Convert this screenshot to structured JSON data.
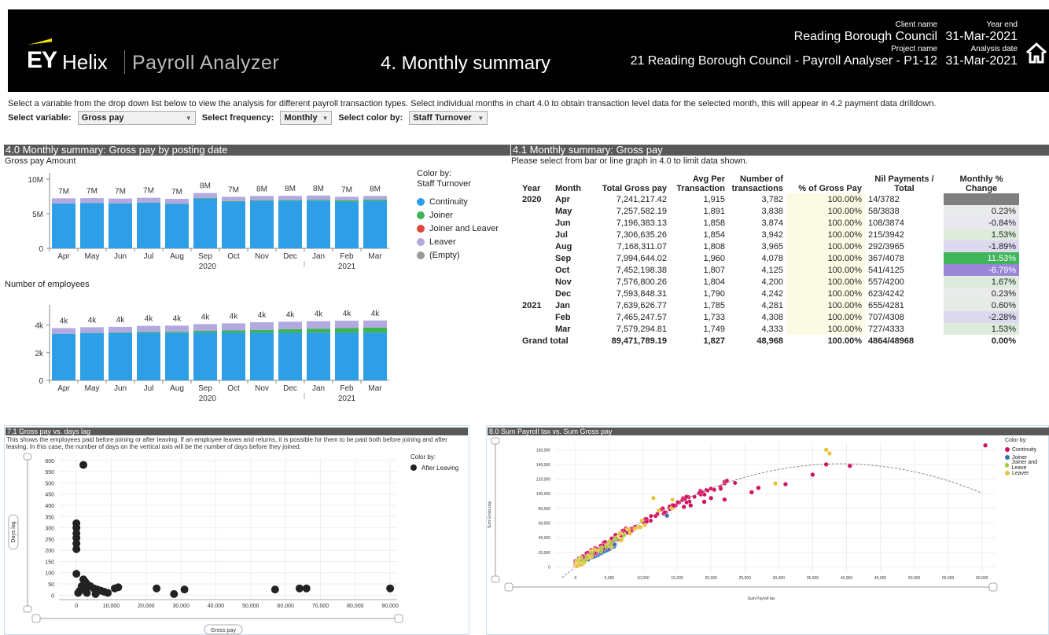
{
  "header": {
    "logo_ey": "EY",
    "logo_helix": "Helix",
    "logo_product": "Payroll Analyzer",
    "page_title": "4. Monthly summary",
    "client_label": "Client name",
    "client_value": "Reading Borough Council",
    "project_label": "Project name",
    "project_value": "21 Reading Borough Council - Payroll Analyser - P1-12",
    "yearend_label": "Year end",
    "yearend_value": "31-Mar-2021",
    "analysisdate_label": "Analysis date",
    "analysisdate_value": "31-Mar-2021",
    "home_icon": "home-icon"
  },
  "instructions": "Select a variable from the drop down list below to view the analysis for different payroll transaction types. Select individual months in chart 4.0 to obtain transaction level data for the selected month, this will appear in 4.2 payment data drilldown.",
  "controls": {
    "variable_label": "Select variable:",
    "variable_value": "Gross pay",
    "frequency_label": "Select frequency:",
    "frequency_value": "Monthly",
    "color_label": "Select color by:",
    "color_value": "Staff Turnover"
  },
  "section40": {
    "title": "4.0 Monthly summary: Gross pay by posting date",
    "chart1_title": "Gross pay Amount",
    "chart2_title": "Number of employees",
    "legend_title1": "Color by:",
    "legend_title2": "Staff Turnover",
    "legend": [
      {
        "label": "Continuity",
        "color": "#2e9fe6"
      },
      {
        "label": "Joiner",
        "color": "#3cb454"
      },
      {
        "label": "Joiner and Leaver",
        "color": "#e0473c"
      },
      {
        "label": "Leaver",
        "color": "#b3a8e0"
      },
      {
        "label": "(Empty)",
        "color": "#9a9a9a"
      }
    ],
    "months": [
      "Apr",
      "May",
      "Jun",
      "Jul",
      "Aug",
      "Sep",
      "Oct",
      "Nov",
      "Dec",
      "Jan",
      "Feb",
      "Mar"
    ],
    "years": [
      "2020",
      "2021"
    ],
    "chart1_ticks": [
      "10M",
      "5M",
      "0"
    ],
    "chart2_ticks": [
      "4k",
      "2k",
      "0"
    ]
  },
  "chart_data": [
    {
      "type": "bar",
      "title": "Gross pay Amount",
      "categories": [
        "Apr",
        "May",
        "Jun",
        "Jul",
        "Aug",
        "Sep",
        "Oct",
        "Nov",
        "Dec",
        "Jan",
        "Feb",
        "Mar"
      ],
      "ylim": [
        0,
        10000000
      ],
      "data_labels": [
        "7M",
        "7M",
        "7M",
        "7M",
        "7M",
        "8M",
        "7M",
        "8M",
        "8M",
        "8M",
        "7M",
        "8M"
      ],
      "series": [
        {
          "name": "Continuity",
          "values": [
            6500000,
            6550000,
            6480000,
            6600000,
            6420000,
            7200000,
            6750000,
            6870000,
            6870000,
            6910000,
            6750000,
            6860000
          ]
        },
        {
          "name": "Joiner",
          "values": [
            0,
            20000,
            30000,
            30000,
            40000,
            70000,
            80000,
            100000,
            110000,
            120000,
            200000,
            200000
          ]
        },
        {
          "name": "Joiner and Leaver",
          "values": [
            0,
            0,
            0,
            0,
            0,
            0,
            0,
            0,
            0,
            0,
            0,
            0
          ]
        },
        {
          "name": "Leaver",
          "values": [
            740000,
            690000,
            690000,
            680000,
            700000,
            720000,
            620000,
            610000,
            610000,
            610000,
            510000,
            520000
          ]
        }
      ]
    },
    {
      "type": "bar",
      "title": "Number of employees",
      "categories": [
        "Apr",
        "May",
        "Jun",
        "Jul",
        "Aug",
        "Sep",
        "Oct",
        "Nov",
        "Dec",
        "Jan",
        "Feb",
        "Mar"
      ],
      "ylim": [
        0,
        5000
      ],
      "data_labels": [
        "4k",
        "4k",
        "4k",
        "4k",
        "4k",
        "4k",
        "4k",
        "4k",
        "4k",
        "4k",
        "4k",
        "4k"
      ],
      "series": [
        {
          "name": "Continuity",
          "values": [
            3370,
            3420,
            3430,
            3440,
            3430,
            3460,
            3440,
            3440,
            3440,
            3450,
            3440,
            3450
          ]
        },
        {
          "name": "Joiner",
          "values": [
            0,
            20,
            40,
            60,
            80,
            120,
            170,
            210,
            260,
            290,
            340,
            370
          ]
        },
        {
          "name": "Joiner and Leaver",
          "values": [
            0,
            0,
            0,
            0,
            0,
            0,
            0,
            0,
            0,
            0,
            0,
            0
          ]
        },
        {
          "name": "Leaver",
          "values": [
            410,
            400,
            400,
            440,
            450,
            490,
            510,
            550,
            540,
            540,
            530,
            510
          ]
        }
      ]
    },
    {
      "type": "scatter",
      "title": "7.1 Gross pay vs. days lag",
      "xlabel": "Gross pay",
      "ylabel": "Days lag",
      "xlim": [
        -5000,
        92000
      ],
      "ylim": [
        -20,
        610
      ],
      "series": [
        {
          "name": "After Leaving",
          "color": "#222222",
          "points": [
            [
              2000,
              580
            ],
            [
              0,
              320
            ],
            [
              0,
              300
            ],
            [
              0,
              275
            ],
            [
              0,
              255
            ],
            [
              0,
              230
            ],
            [
              0,
              205
            ],
            [
              0,
              95
            ],
            [
              2000,
              70
            ],
            [
              2500,
              60
            ],
            [
              3000,
              50
            ],
            [
              4000,
              40
            ],
            [
              5000,
              30
            ],
            [
              6000,
              25
            ],
            [
              7000,
              20
            ],
            [
              8000,
              15
            ],
            [
              9000,
              10
            ],
            [
              11000,
              30
            ],
            [
              12000,
              35
            ],
            [
              1000,
              20
            ],
            [
              3000,
              10
            ],
            [
              5500,
              5
            ],
            [
              500,
              10
            ],
            [
              1500,
              40
            ],
            [
              2500,
              25
            ],
            [
              23000,
              30
            ],
            [
              28000,
              5
            ],
            [
              31000,
              25
            ],
            [
              57000,
              25
            ],
            [
              66000,
              30
            ],
            [
              64000,
              30
            ],
            [
              90000,
              30
            ]
          ]
        }
      ]
    },
    {
      "type": "scatter",
      "title": "8.0 Sum Payroll tax vs. Sum Gross pay",
      "xlabel": "Sum Payroll tax",
      "ylabel": "Sum Gross pay",
      "xlim": [
        -3000,
        62000
      ],
      "ylim": [
        -6000,
        170000
      ],
      "series": [
        {
          "name": "Continuity",
          "color": "#d0125f"
        },
        {
          "name": "Joiner",
          "color": "#3a6fa6"
        },
        {
          "name": "Joiner and Leaver",
          "color": "#a6c83c"
        },
        {
          "name": "Leaver",
          "color": "#e8c23a"
        }
      ]
    }
  ],
  "section41": {
    "title": "4.1 Monthly summary: Gross pay",
    "subtitle": "Please select from bar or line graph in 4.0 to limit data shown.",
    "columns": [
      "Year",
      "Month",
      "Total Gross pay",
      "Avg Per Transaction",
      "Number of transactions",
      "% of Gross Pay",
      "Nil Payments / Total",
      "Monthly % Change"
    ],
    "rows": [
      {
        "year": "2020",
        "month": "Apr",
        "total": "7,241,217.42",
        "avg": "1,915",
        "num": "3,782",
        "pct": "100.00%",
        "nil": "14/3782",
        "chg": "",
        "chg_color": "#7f7f7f"
      },
      {
        "year": "",
        "month": "May",
        "total": "7,257,582.19",
        "avg": "1,891",
        "num": "3,838",
        "pct": "100.00%",
        "nil": "58/3838",
        "chg": "0.23%",
        "chg_color": "#e9eaea"
      },
      {
        "year": "",
        "month": "Jun",
        "total": "7,196,383.13",
        "avg": "1,858",
        "num": "3,874",
        "pct": "100.00%",
        "nil": "108/3874",
        "chg": "-0.84%",
        "chg_color": "#e8e6f0"
      },
      {
        "year": "",
        "month": "Jul",
        "total": "7,306,635.26",
        "avg": "1,854",
        "num": "3,942",
        "pct": "100.00%",
        "nil": "215/3942",
        "chg": "1.53%",
        "chg_color": "#dcebdc"
      },
      {
        "year": "",
        "month": "Aug",
        "total": "7,168,311.07",
        "avg": "1,808",
        "num": "3,965",
        "pct": "100.00%",
        "nil": "292/3965",
        "chg": "-1.89%",
        "chg_color": "#dcd8ee"
      },
      {
        "year": "",
        "month": "Sep",
        "total": "7,994,644.02",
        "avg": "1,960",
        "num": "4,078",
        "pct": "100.00%",
        "nil": "367/4078",
        "chg": "11.53%",
        "chg_color": "#3fb55a"
      },
      {
        "year": "",
        "month": "Oct",
        "total": "7,452,198.38",
        "avg": "1,807",
        "num": "4,125",
        "pct": "100.00%",
        "nil": "541/4125",
        "chg": "-6.79%",
        "chg_color": "#9a86d6"
      },
      {
        "year": "",
        "month": "Nov",
        "total": "7,576,800.26",
        "avg": "1,804",
        "num": "4,200",
        "pct": "100.00%",
        "nil": "557/4200",
        "chg": "1.67%",
        "chg_color": "#dcebdc"
      },
      {
        "year": "",
        "month": "Dec",
        "total": "7,593,848.31",
        "avg": "1,790",
        "num": "4,242",
        "pct": "100.00%",
        "nil": "623/4242",
        "chg": "0.23%",
        "chg_color": "#e9eaea"
      },
      {
        "year": "2021",
        "month": "Jan",
        "total": "7,639,626.77",
        "avg": "1,785",
        "num": "4,281",
        "pct": "100.00%",
        "nil": "655/4281",
        "chg": "0.60%",
        "chg_color": "#e6ebe6"
      },
      {
        "year": "",
        "month": "Feb",
        "total": "7,465,247.57",
        "avg": "1,733",
        "num": "4,308",
        "pct": "100.00%",
        "nil": "707/4308",
        "chg": "-2.28%",
        "chg_color": "#dcd8ee"
      },
      {
        "year": "",
        "month": "Mar",
        "total": "7,579,294.81",
        "avg": "1,749",
        "num": "4,333",
        "pct": "100.00%",
        "nil": "727/4333",
        "chg": "1.53%",
        "chg_color": "#dcebdc"
      }
    ],
    "grand": {
      "label": "Grand total",
      "total": "89,471,789.19",
      "avg": "1,827",
      "num": "48,968",
      "pct": "100.00%",
      "nil": "4864/48968",
      "chg": "0.00%"
    }
  },
  "section71": {
    "title": "7.1 Gross pay vs. days lag",
    "desc": "This shows the employees paid before joining or after leaving. If an employee leaves and returns, it is possible for them to be paid both before joining and after leaving. In this case, the number of days on the vertical axis will be the number of days before they joined.",
    "ylabel": "Days lag",
    "xlabel": "Gross pay",
    "legend_title": "Color by:",
    "legend_item": "After Leaving",
    "yticks": [
      "600",
      "550",
      "500",
      "450",
      "400",
      "350",
      "300",
      "250",
      "200",
      "150",
      "100",
      "50",
      "0"
    ],
    "xticks": [
      "0",
      "10,000",
      "20,000",
      "30,000",
      "40,000",
      "50,000",
      "60,000",
      "70,000",
      "80,000",
      "90,000"
    ]
  },
  "section80": {
    "title": "8.0 Sum Payroll tax vs. Sum Gross pay",
    "ylabel": "Sum Gross pay",
    "xlabel": "Sum Payroll tax",
    "legend_title": "Color by:",
    "legend": [
      "Continuity",
      "Joiner",
      "Joiner and Leave",
      "Leaver"
    ],
    "yticks": [
      "160,000",
      "140,000",
      "120,000",
      "100,000",
      "80,000",
      "60,000",
      "40,000",
      "20,000",
      "0"
    ],
    "xticks": [
      "0",
      "5,000",
      "10,000",
      "15,000",
      "20,000",
      "25,000",
      "30,000",
      "35,000",
      "40,000",
      "45,000",
      "50,000",
      "55,000",
      "60,000"
    ]
  }
}
